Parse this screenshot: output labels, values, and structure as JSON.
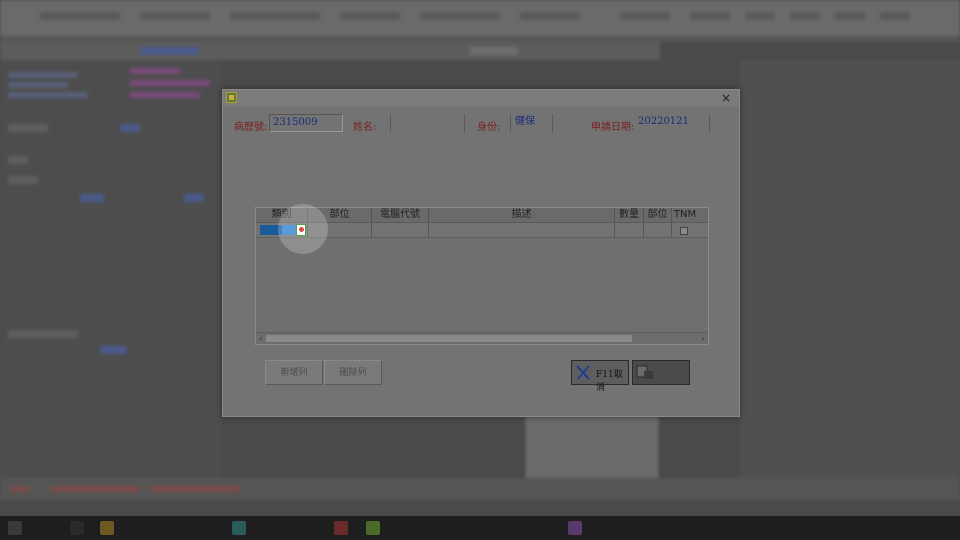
{
  "dialog": {
    "close_symbol": "×",
    "fields": {
      "chart_no_label": "病歷號:",
      "chart_no_value": "2315009",
      "name_label": "姓名:",
      "identity_label": "身份:",
      "identity_value": "健保",
      "apply_date_label": "申請日期:",
      "apply_date_value": "20220121"
    },
    "grid": {
      "columns": [
        "類別",
        "部位",
        "電腦代號",
        "描述",
        "數量",
        "部位",
        "TNM"
      ],
      "scroll_left": "‹",
      "scroll_right": "›"
    },
    "buttons": {
      "add_row": "新增列",
      "delete_row": "刪除列",
      "cancel": "F11取消"
    }
  },
  "colors": {
    "label": "#7a2020",
    "value": "#1a2a7a",
    "selection": "#1a5b9a"
  },
  "icons": {
    "app": "app-icon",
    "close": "close-icon",
    "cancel": "x-icon",
    "confirm": "confirm-icon",
    "dropdown": "dropdown-icon"
  }
}
